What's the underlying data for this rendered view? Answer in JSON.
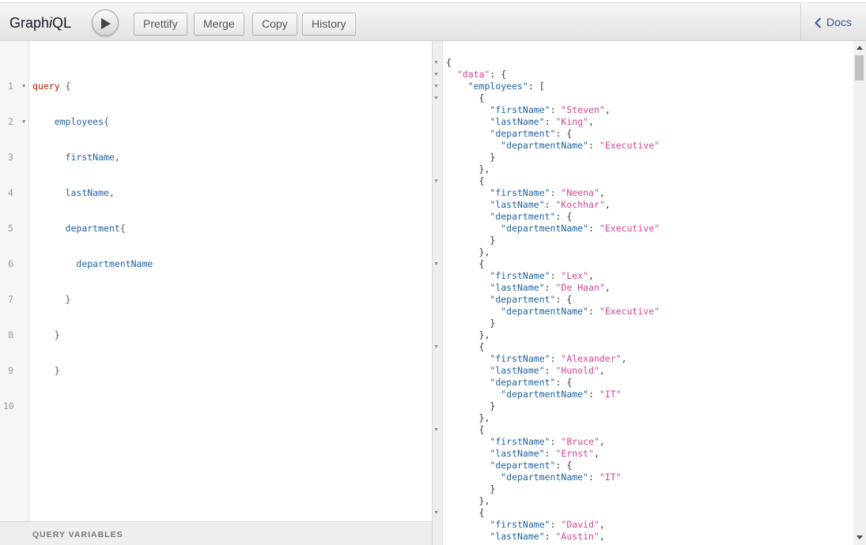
{
  "toolbar": {
    "title_prefix": "Graph",
    "title_italic": "i",
    "title_suffix": "QL",
    "prettify": "Prettify",
    "merge": "Merge",
    "copy": "Copy",
    "history": "History",
    "docs": "Docs"
  },
  "query_line_numbers": [
    "1",
    "2",
    "3",
    "4",
    "5",
    "6",
    "7",
    "8",
    "9",
    "10"
  ],
  "query_editor": {
    "l1_kw": "query",
    "l1_brace": " {",
    "l2_indent": "    ",
    "l2_field": "employees",
    "l2_brace": "{",
    "l3_indent": "      ",
    "l3_field": "firstName",
    "l3_punc": ",",
    "l4_indent": "      ",
    "l4_field": "lastName",
    "l4_punc": ",",
    "l5_indent": "      ",
    "l5_field": "department",
    "l5_brace": "{",
    "l6_indent": "        ",
    "l6_field": "departmentName",
    "l7": "      }",
    "l8": "    }",
    "l9": "    }",
    "l10": ""
  },
  "variables_label": "QUERY VARIABLES",
  "result": {
    "open": "{",
    "data_key": "\"data\"",
    "employees_key": "\"employees\"",
    "first_name_key": "\"firstName\"",
    "last_name_key": "\"lastName\"",
    "department_key": "\"department\"",
    "department_name_key": "\"departmentName\"",
    "employees": [
      {
        "firstName": "\"Steven\"",
        "lastName": "\"King\"",
        "departmentName": "\"Executive\""
      },
      {
        "firstName": "\"Neena\"",
        "lastName": "\"Kochhar\"",
        "departmentName": "\"Executive\""
      },
      {
        "firstName": "\"Lex\"",
        "lastName": "\"De Haan\"",
        "departmentName": "\"Executive\""
      },
      {
        "firstName": "\"Alexander\"",
        "lastName": "\"Hunold\"",
        "departmentName": "\"IT\""
      },
      {
        "firstName": "\"Bruce\"",
        "lastName": "\"Ernst\"",
        "departmentName": "\"IT\""
      },
      {
        "firstName": "\"David\"",
        "lastName": "\"Austin\"",
        "departmentName": null
      }
    ]
  },
  "icons": {
    "execute": "play-icon",
    "docs": "chevron-left-icon"
  }
}
